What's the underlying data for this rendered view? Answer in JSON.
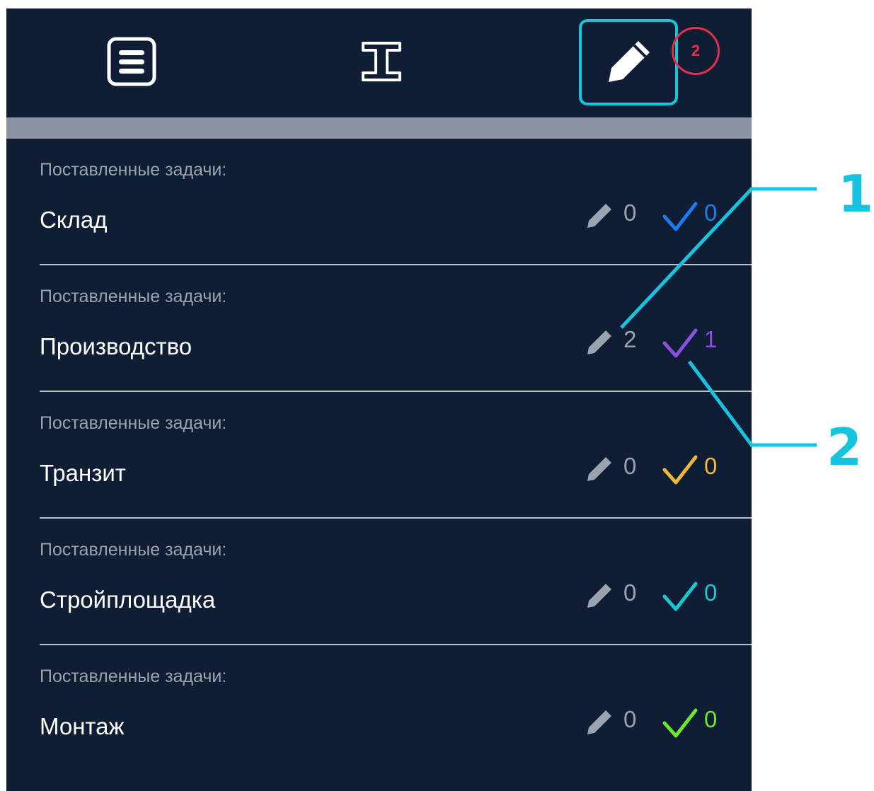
{
  "toolbar": {
    "tabs": [
      {
        "icon": "list-icon"
      },
      {
        "icon": "text-cursor-icon"
      },
      {
        "icon": "pencil-icon",
        "selected": true
      }
    ],
    "badge": "2"
  },
  "rows": [
    {
      "caption": "Поставленные задачи:",
      "title": "Склад",
      "drafts": "0",
      "done": "0",
      "check_color": "#1e7cf2"
    },
    {
      "caption": "Поставленные задачи:",
      "title": "Производство",
      "drafts": "2",
      "done": "1",
      "check_color": "#8a4fe0"
    },
    {
      "caption": "Поставленные задачи:",
      "title": "Транзит",
      "drafts": "0",
      "done": "0",
      "check_color": "#f4b63a"
    },
    {
      "caption": "Поставленные задачи:",
      "title": "Стройплощадка",
      "drafts": "0",
      "done": "0",
      "check_color": "#18c9d4"
    },
    {
      "caption": "Поставленные задачи:",
      "title": "Монтаж",
      "drafts": "0",
      "done": "0",
      "check_color": "#6ee62a"
    }
  ],
  "callouts": [
    {
      "label": "1"
    },
    {
      "label": "2"
    }
  ],
  "colors": {
    "background": "#0f1e34",
    "highlight": "#12c7d8",
    "badge": "#e2314a",
    "callout": "#17c4e0"
  }
}
